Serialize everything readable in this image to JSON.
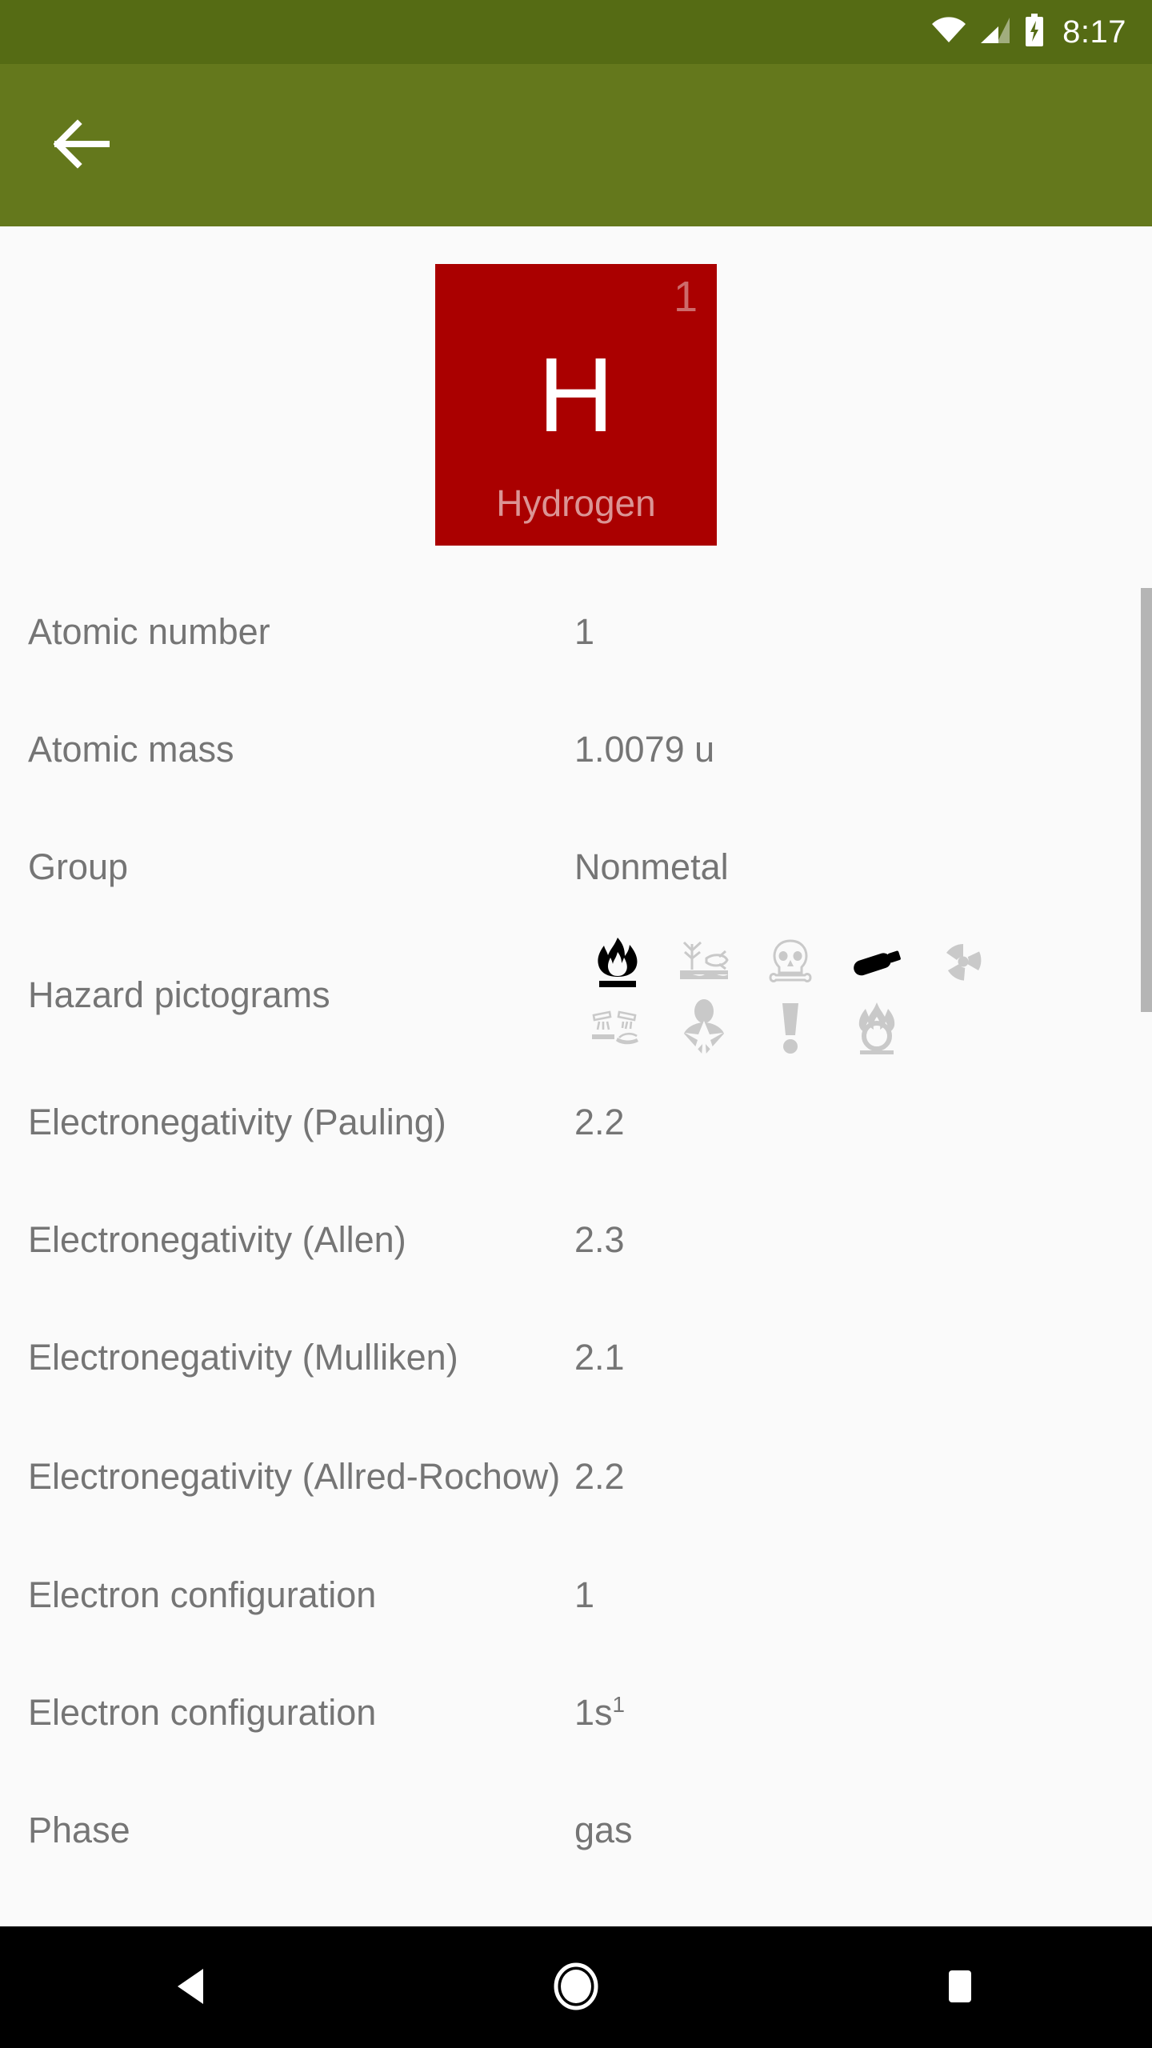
{
  "status_bar": {
    "time": "8:17",
    "background_color": "#556B14",
    "icons": [
      "wifi-icon",
      "cellular-signal-icon",
      "battery-charging-icon"
    ]
  },
  "app_bar": {
    "background_color": "#64781C",
    "back_label": "Back"
  },
  "element": {
    "atomic_number_badge": "1",
    "symbol": "H",
    "name": "Hydrogen",
    "tile_color": "#AA0000"
  },
  "properties": [
    {
      "label": "Atomic number",
      "value": "1"
    },
    {
      "label": "Atomic mass",
      "value": "1.0079  u"
    },
    {
      "label": "Group",
      "value": "Nonmetal"
    },
    {
      "label": "Hazard pictograms",
      "value": ""
    },
    {
      "label": "Electronegativity (Pauling)",
      "value": "2.2"
    },
    {
      "label": "Electronegativity (Allen)",
      "value": "2.3"
    },
    {
      "label": "Electronegativity (Mulliken)",
      "value": "2.1"
    },
    {
      "label": "Electronegativity (Allred-Rochow)",
      "value": "2.2"
    },
    {
      "label": "Electron configuration",
      "value": "1"
    },
    {
      "label": "Electron configuration",
      "value": "1s",
      "superscript": "1"
    },
    {
      "label": "Phase",
      "value": "gas"
    }
  ],
  "hazard_pictograms": [
    {
      "name": "flame-icon",
      "active": true
    },
    {
      "name": "environment-icon",
      "active": false
    },
    {
      "name": "skull-crossbones-icon",
      "active": false
    },
    {
      "name": "gas-cylinder-icon",
      "active": true
    },
    {
      "name": "radioactive-icon",
      "active": false
    },
    {
      "name": "corrosion-icon",
      "active": false
    },
    {
      "name": "health-hazard-icon",
      "active": false
    },
    {
      "name": "exclamation-mark-icon",
      "active": false
    },
    {
      "name": "oxidizer-flame-circle-icon",
      "active": false
    }
  ],
  "colors": {
    "page_background": "#fafafa",
    "text": "#757575",
    "pictogram_active": "#000000",
    "pictogram_inactive": "#c9c9c9",
    "scrollbar_thumb": "#b5b5b5"
  },
  "nav_bar": {
    "background_color": "#000000",
    "buttons": [
      "back-triangle",
      "home-circle",
      "recents-square"
    ]
  }
}
